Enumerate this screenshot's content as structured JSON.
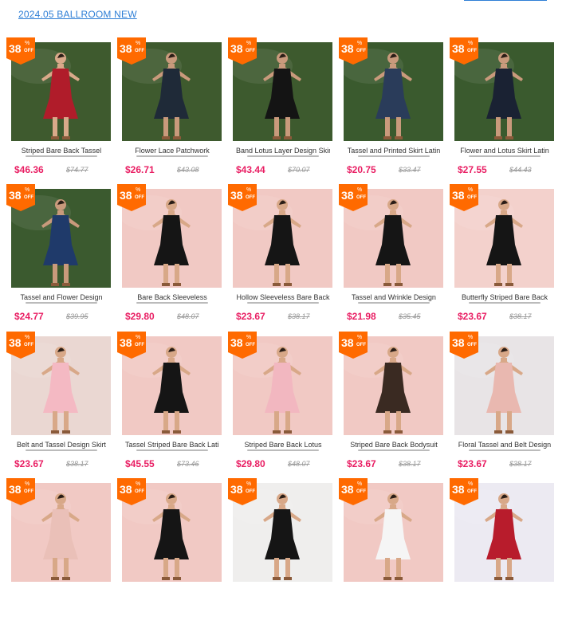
{
  "header": {
    "collection_link": "2024.05 BALLROOM NEW"
  },
  "badge": {
    "discount": "38",
    "percent": "%",
    "off": "OFF"
  },
  "colors": {
    "accent_price": "#e91e63",
    "badge_orange": "#ff6a00",
    "link_blue": "#2f7fd6"
  },
  "products": [
    {
      "title": "Striped Bare Back Tassel",
      "price": "$46.36",
      "original": "$74.77",
      "bg": "#3e5a2e",
      "dress": "#b01c2a",
      "skin": "#d9a98a"
    },
    {
      "title": "Flower Lace Patchwork",
      "price": "$26.71",
      "original": "$43.08",
      "bg": "#3e5a2e",
      "dress": "#1f2a38",
      "skin": "#c99a7c"
    },
    {
      "title": "Band Lotus Layer Design Skirt",
      "price": "$43.44",
      "original": "$70.07",
      "bg": "#3d5a2e",
      "dress": "#141414",
      "skin": "#c99a7c"
    },
    {
      "title": "Tassel and Printed Skirt Latin",
      "price": "$20.75",
      "original": "$33.47",
      "bg": "#3a5a2e",
      "dress": "#2a3c5a",
      "skin": "#c99a7c"
    },
    {
      "title": "Flower and Lotus Skirt Latin",
      "price": "$27.55",
      "original": "$44.43",
      "bg": "#3a5a2e",
      "dress": "#1a2233",
      "skin": "#c99a7c"
    },
    {
      "title": "Tassel and Flower Design",
      "price": "$24.77",
      "original": "$39.95",
      "bg": "#3b5a2f",
      "dress": "#1f3a6a",
      "skin": "#c99a7c"
    },
    {
      "title": "Bare Back Sleeveless",
      "price": "$29.80",
      "original": "$48.07",
      "bg": "#f1c9c4",
      "dress": "#151515",
      "skin": "#d8a888"
    },
    {
      "title": "Hollow Sleeveless Bare Back",
      "price": "$23.67",
      "original": "$38.17",
      "bg": "#f1c9c4",
      "dress": "#151515",
      "skin": "#d8a888"
    },
    {
      "title": "Tassel and Wrinkle Design",
      "price": "$21.98",
      "original": "$35.45",
      "bg": "#f1c9c4",
      "dress": "#151515",
      "skin": "#d8a888"
    },
    {
      "title": "Butterfly Striped Bare Back",
      "price": "$23.67",
      "original": "$38.17",
      "bg": "#f3d1cc",
      "dress": "#151515",
      "skin": "#d8a888"
    },
    {
      "title": "Belt and Tassel Design Skirt",
      "price": "$23.67",
      "original": "$38.17",
      "bg": "#ead7d2",
      "dress": "#f4b9c3",
      "skin": "#d8a888"
    },
    {
      "title": "Tassel Striped Bare Back Latin",
      "price": "$45.55",
      "original": "$73.46",
      "bg": "#f1c9c4",
      "dress": "#151515",
      "skin": "#d8a888"
    },
    {
      "title": "Striped Bare Back Lotus",
      "price": "$29.80",
      "original": "$48.07",
      "bg": "#f1c9c4",
      "dress": "#f2b7c0",
      "skin": "#d8a888"
    },
    {
      "title": "Striped Bare Back Bodysuit",
      "price": "$23.67",
      "original": "$38.17",
      "bg": "#f1c9c4",
      "dress": "#3a2a22",
      "skin": "#d8a888"
    },
    {
      "title": "Floral Tassel and Belt Design",
      "price": "$23.67",
      "original": "$38.17",
      "bg": "#e8e4e6",
      "dress": "#e9b8b0",
      "skin": "#d8a888"
    },
    {
      "title": "",
      "price": "",
      "original": "",
      "bg": "#f1c9c4",
      "dress": "#eac0b8",
      "skin": "#d8a888"
    },
    {
      "title": "",
      "price": "",
      "original": "",
      "bg": "#f1c9c4",
      "dress": "#151515",
      "skin": "#d8a888"
    },
    {
      "title": "",
      "price": "",
      "original": "",
      "bg": "#efeeed",
      "dress": "#151515",
      "skin": "#d8a888"
    },
    {
      "title": "",
      "price": "",
      "original": "",
      "bg": "#f1c9c4",
      "dress": "#f5f5f5",
      "skin": "#d8a888"
    },
    {
      "title": "",
      "price": "",
      "original": "",
      "bg": "#eceaf2",
      "dress": "#b81c2c",
      "skin": "#d8a888"
    }
  ]
}
